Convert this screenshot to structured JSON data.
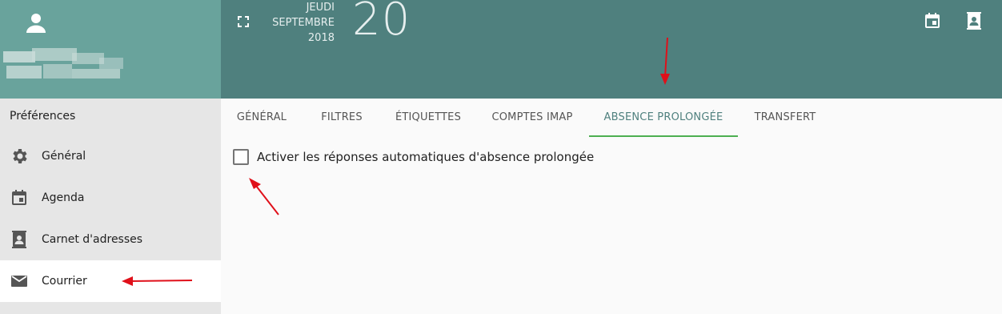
{
  "header": {
    "date_weekday": "JEUDI",
    "date_month": "SEPTEMBRE",
    "date_year": "2018",
    "date_day": "20"
  },
  "sidebar": {
    "title": "Préférences",
    "items": [
      {
        "label": "Général",
        "icon": "gear-icon"
      },
      {
        "label": "Agenda",
        "icon": "calendar-icon"
      },
      {
        "label": "Carnet d'adresses",
        "icon": "contacts-icon"
      },
      {
        "label": "Courrier",
        "icon": "mail-icon"
      }
    ],
    "active_item": "Courrier"
  },
  "tabs": [
    {
      "label": "GÉNÉRAL"
    },
    {
      "label": "FILTRES"
    },
    {
      "label": "ÉTIQUETTES"
    },
    {
      "label": "COMPTES IMAP"
    },
    {
      "label": "ABSENCE PROLONGÉE"
    },
    {
      "label": "TRANSFERT"
    }
  ],
  "active_tab": "ABSENCE PROLONGÉE",
  "content": {
    "auto_reply_label": "Activer les réponses automatiques d'absence prolongée",
    "auto_reply_checked": false
  },
  "colors": {
    "header_bg": "#4f807e",
    "user_panel_bg": "#69a39c",
    "sidebar_bg": "#e6e6e6",
    "active_tab_underline": "#4caf50",
    "annotation_arrow": "#e0101a"
  }
}
